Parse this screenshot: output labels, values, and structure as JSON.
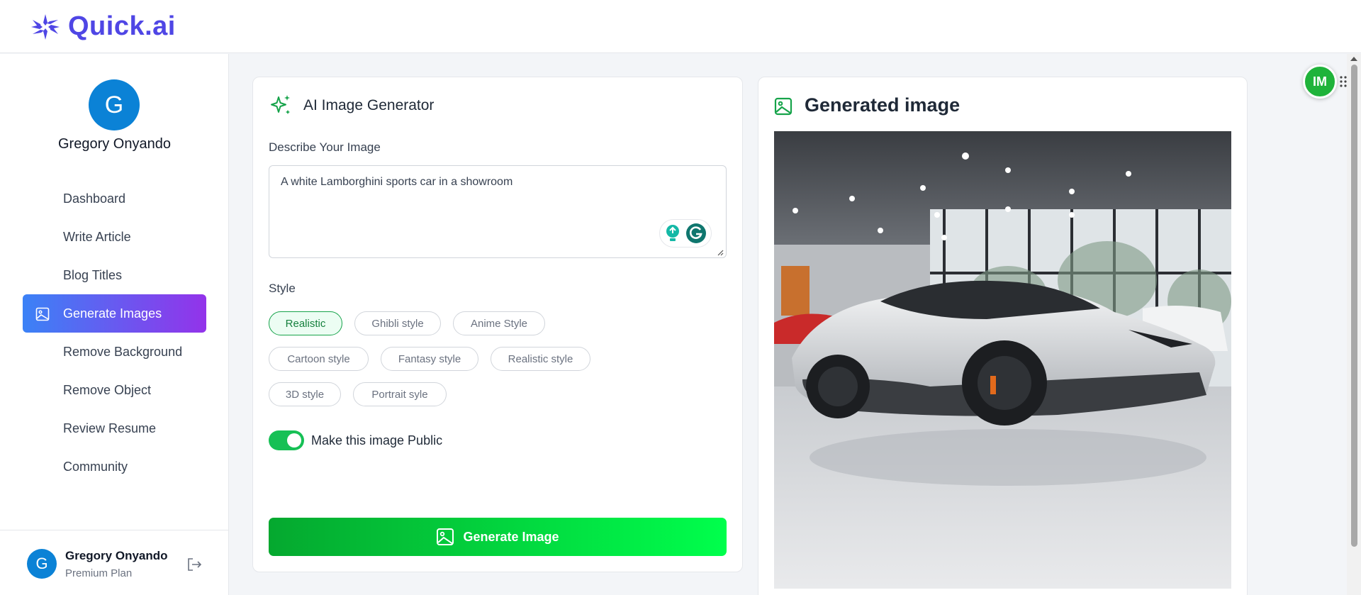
{
  "app": {
    "name": "Quick.ai",
    "brand_color": "#4f46e5"
  },
  "user": {
    "initial": "G",
    "name": "Gregory Onyando",
    "plan": "Premium Plan"
  },
  "sidebar": {
    "items": [
      {
        "label": "Dashboard",
        "active": false
      },
      {
        "label": "Write Article",
        "active": false
      },
      {
        "label": "Blog Titles",
        "active": false
      },
      {
        "label": "Generate Images",
        "active": true
      },
      {
        "label": "Remove Background",
        "active": false
      },
      {
        "label": "Remove Object",
        "active": false
      },
      {
        "label": "Review Resume",
        "active": false
      },
      {
        "label": "Community",
        "active": false
      }
    ]
  },
  "generator": {
    "title": "AI Image Generator",
    "describe_label": "Describe Your Image",
    "prompt_value": "A white Lamborghini sports car in a showroom",
    "style_label": "Style",
    "styles": [
      {
        "label": "Realistic",
        "selected": true
      },
      {
        "label": "Ghibli style",
        "selected": false
      },
      {
        "label": "Anime Style",
        "selected": false
      },
      {
        "label": "Cartoon style",
        "selected": false
      },
      {
        "label": "Fantasy style",
        "selected": false
      },
      {
        "label": "Realistic style",
        "selected": false
      },
      {
        "label": "3D style",
        "selected": false
      },
      {
        "label": "Portrait syle",
        "selected": false
      }
    ],
    "public_toggle_label": "Make this image Public",
    "public_toggle_on": true,
    "generate_button": "Generate Image"
  },
  "result": {
    "title": "Generated image"
  },
  "float_badge": {
    "label": "IM"
  },
  "colors": {
    "accent_green": "#16c055",
    "active_gradient_start": "#3b82f6",
    "active_gradient_end": "#9333ea",
    "avatar_blue": "#0b82d6"
  }
}
